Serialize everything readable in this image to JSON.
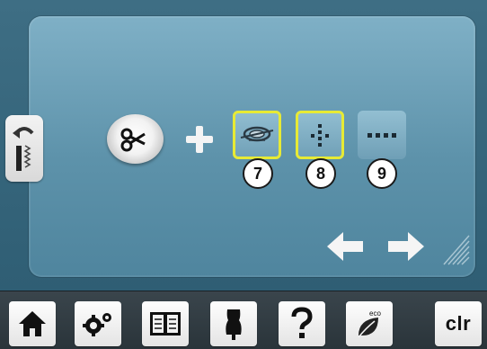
{
  "function_buttons": [
    {
      "number": "7",
      "icon": "thread-cutter-icon",
      "active": true
    },
    {
      "number": "8",
      "icon": "needle-position-icon",
      "active": true
    },
    {
      "number": "9",
      "icon": "dotted-line-icon",
      "active": false
    }
  ],
  "toolbar": {
    "clr_label": "clr"
  },
  "colors": {
    "active_border": "#e7ea35",
    "panel": "#6da0b8",
    "screen": "#2f5e74"
  }
}
